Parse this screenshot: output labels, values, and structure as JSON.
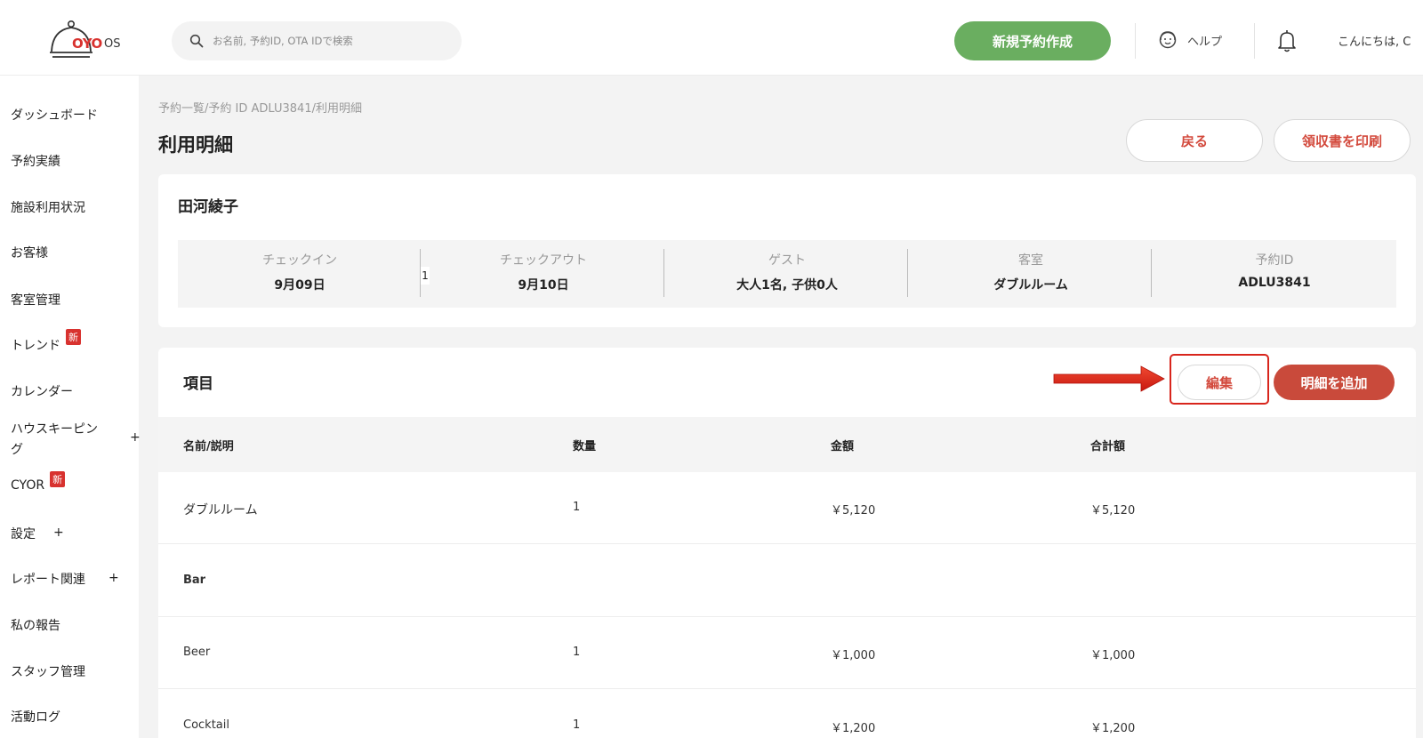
{
  "header": {
    "logo_brand": "OYO",
    "logo_suffix": "OS",
    "search_placeholder": "お名前, 予約ID, OTA IDで検索",
    "new_reservation": "新規予約作成",
    "help": "ヘルプ",
    "greeting": "こんにちは, C"
  },
  "sidebar": {
    "items": [
      {
        "label": "ダッシュボード"
      },
      {
        "label": "予約実績"
      },
      {
        "label": "施設利用状況"
      },
      {
        "label": "お客様"
      },
      {
        "label": "客室管理"
      },
      {
        "label": "トレンド",
        "badge": "新"
      },
      {
        "label": "カレンダー"
      },
      {
        "label": "ハウスキーピン",
        "label2": "グ",
        "plus": "+"
      },
      {
        "label": "CYOR",
        "badge": "新"
      },
      {
        "label": "設定",
        "plus": "+"
      },
      {
        "label": "レポート関連",
        "plus": "+"
      },
      {
        "label": "私の報告"
      },
      {
        "label": "スタッフ管理"
      },
      {
        "label": "活動ログ"
      }
    ]
  },
  "breadcrumb": "予約一覧/予約 ID ADLU3841/利用明細",
  "page_title": "利用明細",
  "actions": {
    "back": "戻る",
    "print_receipt": "領収書を印刷"
  },
  "booking": {
    "guest_name": "田河綾子",
    "stray_char": "1",
    "fields": [
      {
        "label": "チェックイン",
        "value": "9月09日"
      },
      {
        "label": "チェックアウト",
        "value": "9月10日"
      },
      {
        "label": "ゲスト",
        "value": "大人1名, 子供0人"
      },
      {
        "label": "客室",
        "value": "ダブルルーム"
      },
      {
        "label": "予約ID",
        "value": "ADLU3841"
      }
    ]
  },
  "items_section": {
    "title": "項目",
    "edit": "編集",
    "add_detail": "明細を追加",
    "columns": [
      "名前/説明",
      "数量",
      "金額",
      "合計額"
    ],
    "rows": [
      {
        "name": "ダブルルーム",
        "qty": "1",
        "price": "￥5,120",
        "total": "￥5,120"
      },
      {
        "name": "Bar",
        "qty": "",
        "price": "",
        "total": ""
      },
      {
        "name": "Beer",
        "qty": "1",
        "price": "￥1,000",
        "total": "￥1,000"
      },
      {
        "name": "Cocktail",
        "qty": "1",
        "price": "￥1,200",
        "total": "￥1,200"
      }
    ]
  },
  "colors": {
    "accent_green": "#6aae60",
    "accent_red": "#c94a3b",
    "annotation_red": "#d8251c"
  }
}
